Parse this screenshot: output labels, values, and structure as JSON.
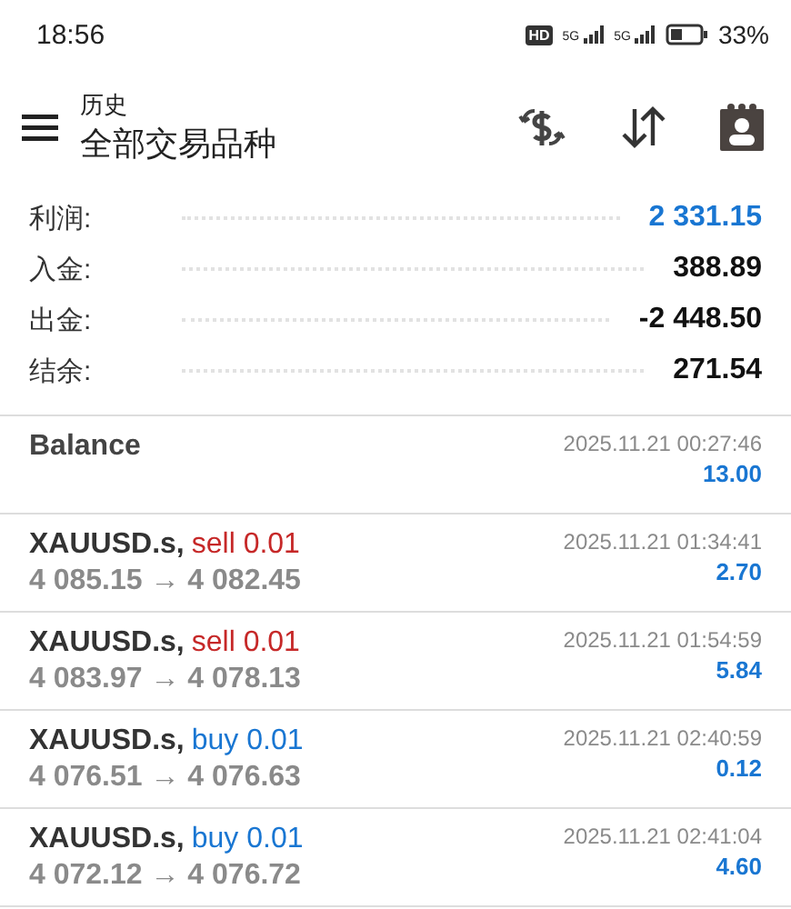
{
  "status_bar": {
    "time": "18:56",
    "hd_badge": "HD",
    "signal_1_label": "5G",
    "signal_2_label": "5G",
    "battery": "33%"
  },
  "header": {
    "title": "历史",
    "subtitle": "全部交易品种"
  },
  "summary": [
    {
      "label": "利润:",
      "value": "2 331.15",
      "color": "#1976d2"
    },
    {
      "label": "入金:",
      "value": "388.89",
      "color": "#111111"
    },
    {
      "label": "出金:",
      "value": "-2 448.50",
      "color": "#111111"
    },
    {
      "label": "结余:",
      "value": "271.54",
      "color": "#111111"
    }
  ],
  "deals": [
    {
      "kind": "balance",
      "symbol": "Balance",
      "time": "2025.11.21 00:27:46",
      "amount": "13.00"
    },
    {
      "kind": "sell",
      "symbol": "XAUUSD.s,",
      "action": "sell 0.01",
      "prices": "4 085.15 → 4 082.45",
      "time": "2025.11.21 01:34:41",
      "amount": "2.70"
    },
    {
      "kind": "sell",
      "symbol": "XAUUSD.s,",
      "action": "sell 0.01",
      "prices": "4 083.97 → 4 078.13",
      "time": "2025.11.21 01:54:59",
      "amount": "5.84"
    },
    {
      "kind": "buy",
      "symbol": "XAUUSD.s,",
      "action": "buy 0.01",
      "prices": "4 076.51 → 4 076.63",
      "time": "2025.11.21 02:40:59",
      "amount": "0.12"
    },
    {
      "kind": "buy",
      "symbol": "XAUUSD.s,",
      "action": "buy 0.01",
      "prices": "4 072.12 → 4 076.72",
      "time": "2025.11.21 02:41:04",
      "amount": "4.60"
    }
  ]
}
